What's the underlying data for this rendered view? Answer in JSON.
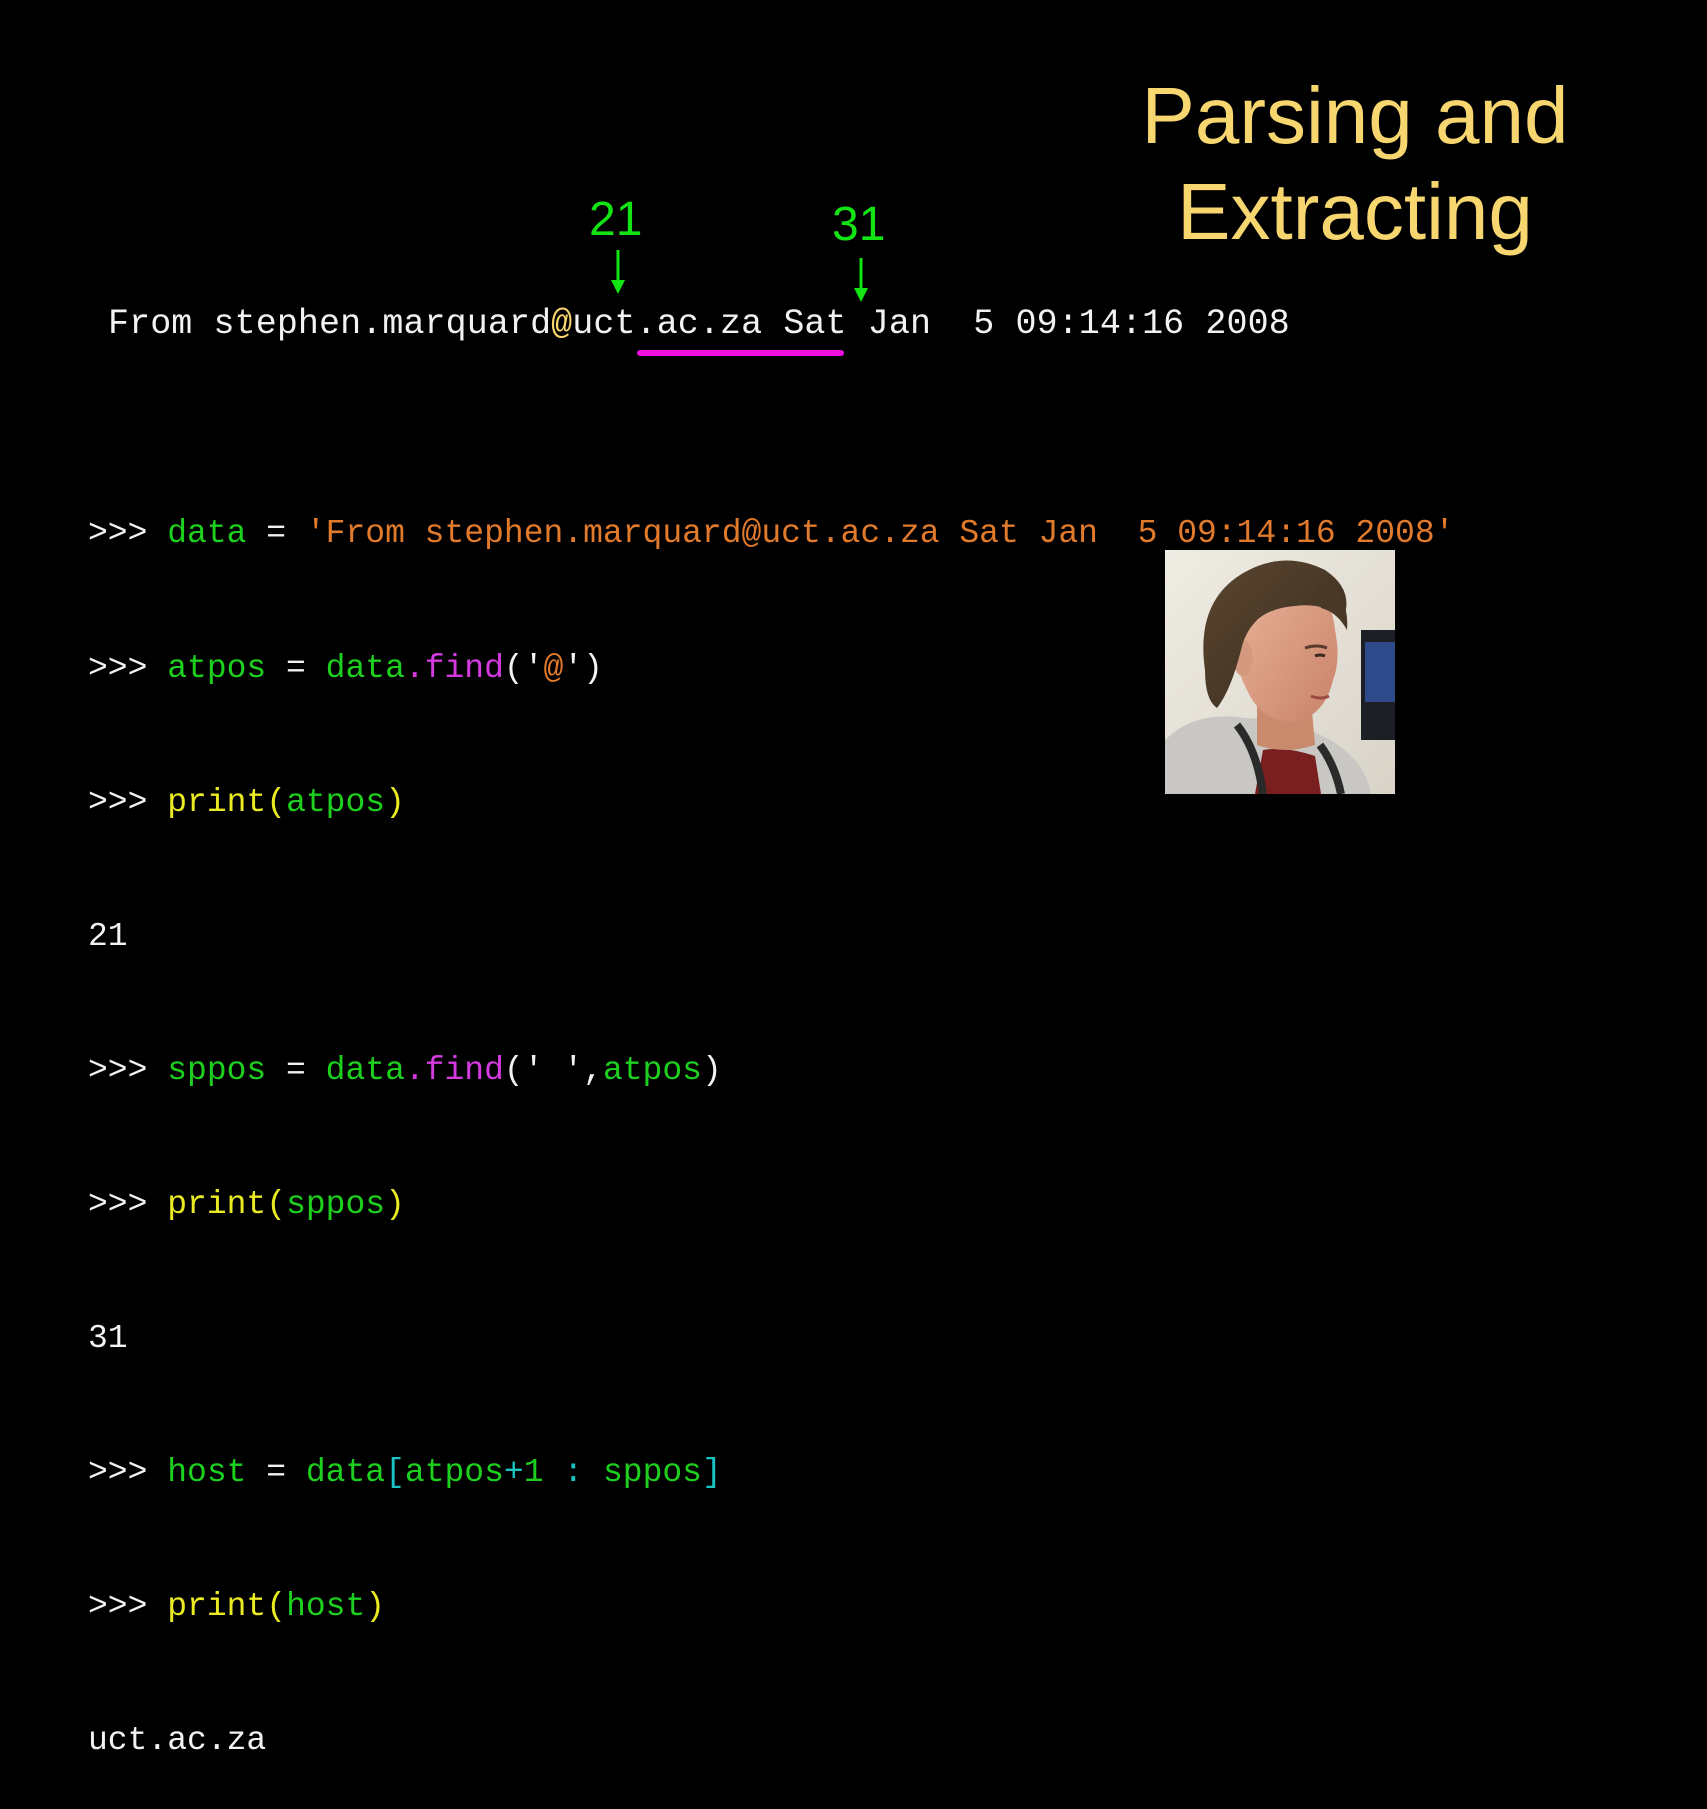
{
  "title": {
    "line1": "Parsing and",
    "line2": "Extracting"
  },
  "markers": {
    "at_index": "21",
    "space_index": "31"
  },
  "from_line": {
    "before_at": "From stephen.marquard",
    "at": "@",
    "host": "uct.ac.za",
    "after": " Sat Jan  5 09:14:16 2008"
  },
  "code": {
    "prompt": ">>> ",
    "l1_var": "data",
    "l1_eq": " = ",
    "l1_str": "'From stephen.marquard@uct.ac.za Sat Jan  5 09:14:16 2008'",
    "l2_var": "atpos",
    "l2_eq": " = ",
    "l2_obj": "data",
    "l2_method": ".find",
    "l2_open": "('",
    "l2_arg": "@",
    "l2_close": "')",
    "l3_print": "print",
    "l3_open": "(",
    "l3_arg": "atpos",
    "l3_close": ")",
    "out1": "21",
    "l4_var": "sppos",
    "l4_eq": " = ",
    "l4_obj": "data",
    "l4_method": ".find",
    "l4_open": "('",
    "l4_arg": " ",
    "l4_mid": "',",
    "l4_arg2": "atpos",
    "l4_close": ")",
    "l5_print": "print",
    "l5_open": "(",
    "l5_arg": "sppos",
    "l5_close": ")",
    "out2": "31",
    "l6_var": "host",
    "l6_eq": " = ",
    "l6_obj": "data",
    "l6_lb": "[",
    "l6_a": "atpos",
    "l6_plus": "+",
    "l6_one": "1",
    "l6_colon": " : ",
    "l6_b": "sppos",
    "l6_rb": "]",
    "l7_print": "print",
    "l7_open": "(",
    "l7_arg": "host",
    "l7_close": ")",
    "out3": "uct.ac.za"
  },
  "colors": {
    "background": "#000000",
    "title": "#f7d56f",
    "marker": "#13e413",
    "underline": "#ee10e0",
    "string": "#e27a2c",
    "variable": "#1ed01e",
    "method": "#d43ae0",
    "print": "#eaea22"
  },
  "photo": {
    "description_icon": "person-photo"
  }
}
